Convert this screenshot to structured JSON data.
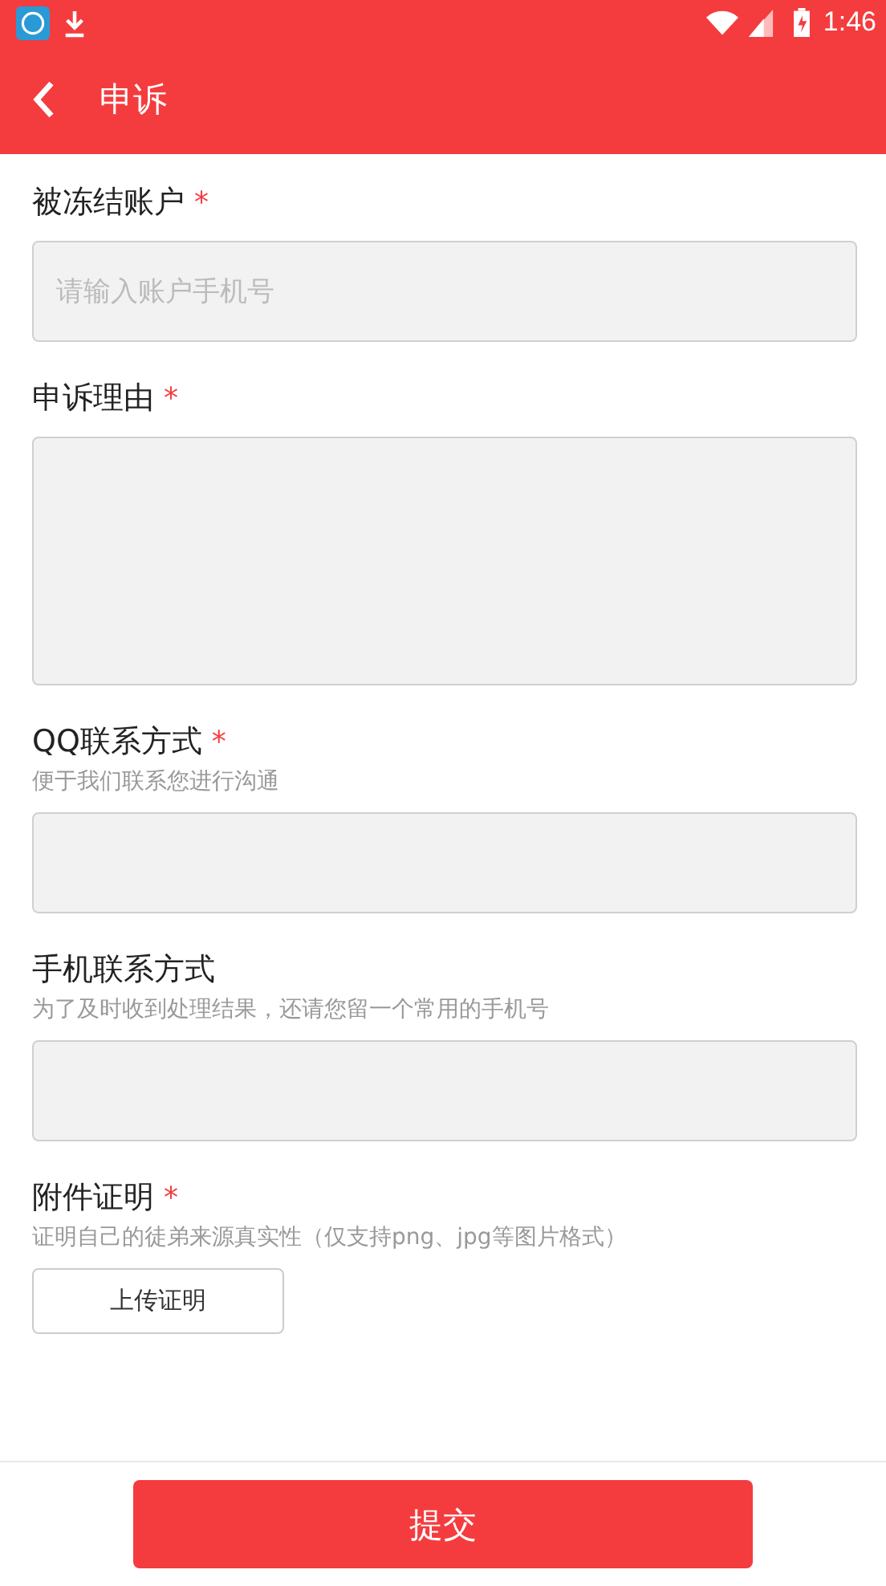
{
  "status_bar": {
    "time": "1:46"
  },
  "header": {
    "title": "申诉"
  },
  "fields": [
    {
      "kind": "input",
      "label": "被冻结账户",
      "required_mark": "*",
      "placeholder": "请输入账户手机号"
    },
    {
      "kind": "textarea",
      "label": "申诉理由",
      "required_mark": "*"
    },
    {
      "kind": "input",
      "label": "QQ联系方式",
      "required_mark": "*",
      "hint": "便于我们联系您进行沟通"
    },
    {
      "kind": "input",
      "label": "手机联系方式",
      "hint": "为了及时收到处理结果，还请您留一个常用的手机号"
    },
    {
      "kind": "upload",
      "label": "附件证明",
      "required_mark": "*",
      "hint": "证明自己的徒弟来源真实性（仅支持png、jpg等图片格式）",
      "button": "上传证明"
    }
  ],
  "submit": "提交"
}
